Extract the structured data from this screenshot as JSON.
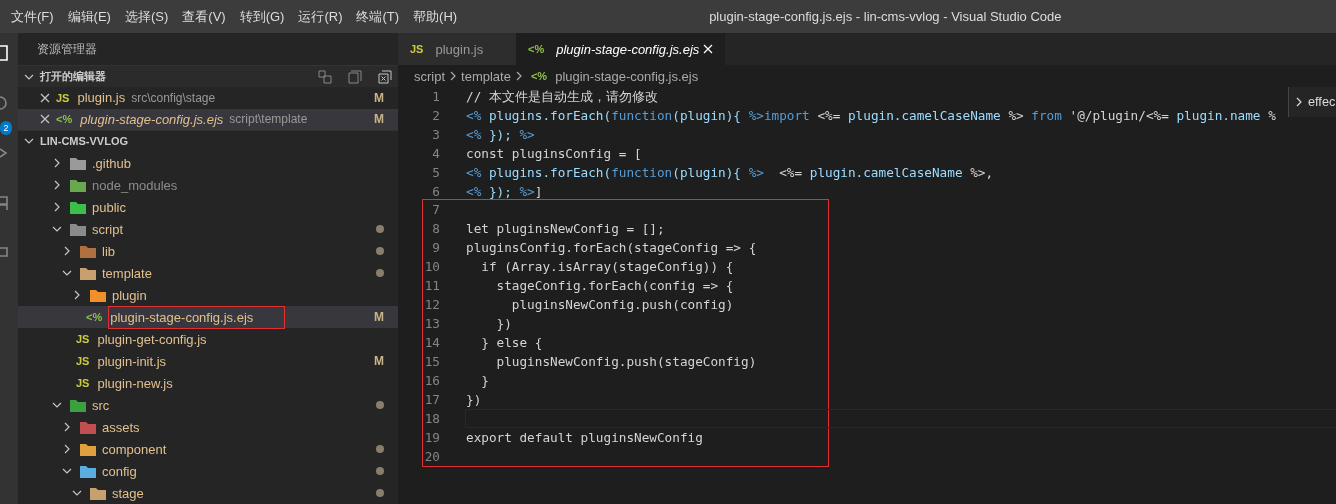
{
  "menu": [
    "文件(F)",
    "编辑(E)",
    "选择(S)",
    "查看(V)",
    "转到(G)",
    "运行(R)",
    "终端(T)",
    "帮助(H)"
  ],
  "window": {
    "title": "plugin-stage-config.js.ejs - lin-cms-vvlog - Visual Studio Code"
  },
  "activity_bar": {
    "badge": "2"
  },
  "sidebar": {
    "title": "资源管理器",
    "open_editors": {
      "title": "打开的编辑器",
      "expanded": true,
      "items": [
        {
          "icon": "JS",
          "kind": "js",
          "name": "plugin.js",
          "path": "src\\config\\stage",
          "badge": "M",
          "preview": false,
          "selected": false
        },
        {
          "icon": "<%",
          "kind": "ejs",
          "name": "plugin-stage-config.js.ejs",
          "path": "script\\template",
          "badge": "M",
          "preview": true,
          "selected": true
        }
      ]
    },
    "project": {
      "title": "LIN-CMS-VVLOG",
      "expanded": true
    }
  },
  "tree": {
    "items": [
      {
        "kind": "folder",
        "name": ".github",
        "color": "#9a9a9a",
        "expanded": false,
        "selected": false
      },
      {
        "kind": "folder",
        "name": "node_modules",
        "color": "#6aa84f",
        "expanded": false,
        "ignored": true,
        "selected": false
      },
      {
        "kind": "folder",
        "name": "public",
        "color": "#3cbf4a",
        "expanded": false,
        "selected": false
      },
      {
        "kind": "folder",
        "name": "script",
        "color": "#8a8a8a",
        "expanded": true,
        "modified_dot": true,
        "selected": false,
        "children": [
          {
            "kind": "folder",
            "name": "lib",
            "color": "#b07040",
            "expanded": false,
            "modified_dot": true,
            "selected": false
          },
          {
            "kind": "folder",
            "name": "template",
            "color": "#c8a070",
            "expanded": true,
            "modified_dot": true,
            "selected": false,
            "children": [
              {
                "kind": "folder",
                "name": "plugin",
                "color": "#f0902a",
                "expanded": false,
                "selected": false
              },
              {
                "kind": "file",
                "icon": "<%",
                "name": "plugin-stage-config.js.ejs",
                "badge": "M",
                "selected": true,
                "annotated": true
              }
            ]
          },
          {
            "kind": "file",
            "icon": "JS",
            "name": "plugin-get-config.js",
            "selected": false
          },
          {
            "kind": "file",
            "icon": "JS",
            "name": "plugin-init.js",
            "badge": "M",
            "selected": false
          },
          {
            "kind": "file",
            "icon": "JS",
            "name": "plugin-new.js",
            "selected": false
          }
        ]
      },
      {
        "kind": "folder",
        "name": "src",
        "color": "#3ca040",
        "expanded": true,
        "modified_dot": true,
        "selected": false,
        "children": [
          {
            "kind": "folder",
            "name": "assets",
            "color": "#c05050",
            "expanded": false,
            "selected": false
          },
          {
            "kind": "folder",
            "name": "component",
            "color": "#e0a040",
            "expanded": false,
            "modified_dot": true,
            "selected": false
          },
          {
            "kind": "folder",
            "name": "config",
            "color": "#5aaee0",
            "expanded": true,
            "modified_dot": true,
            "selected": false,
            "children": [
              {
                "kind": "folder",
                "name": "stage",
                "color": "#c8a070",
                "expanded": true,
                "modified_dot": true,
                "selected": false
              }
            ]
          }
        ]
      }
    ]
  },
  "tabs": [
    {
      "icon": "JS",
      "kind": "js",
      "label": "plugin.js",
      "selected": false,
      "preview": false
    },
    {
      "icon": "<%",
      "kind": "ejs",
      "label": "plugin-stage-config.js.ejs",
      "selected": true,
      "preview": true
    }
  ],
  "breadcrumb": [
    {
      "label": "script"
    },
    {
      "label": "template"
    },
    {
      "icon": "<%",
      "label": "plugin-stage-config.js.ejs"
    }
  ],
  "hover_widget": {
    "text": "effec"
  },
  "editor": {
    "lines": [
      {
        "number": "1",
        "tokens": [
          {
            "kind": "text",
            "text": "// 本文件是自动生成，请勿修改"
          }
        ]
      },
      {
        "number": "2",
        "tokens": [
          {
            "kind": "tag",
            "text": "<%"
          },
          {
            "kind": "var",
            "text": " plugins.forEach("
          },
          {
            "kind": "kw",
            "text": "function"
          },
          {
            "kind": "var",
            "text": "(plugin){ "
          },
          {
            "kind": "tag",
            "text": "%>"
          },
          {
            "kind": "kw",
            "text": "import"
          },
          {
            "kind": "text",
            "text": " <%="
          },
          {
            "kind": "var",
            "text": " plugin.camelCaseName"
          },
          {
            "kind": "text",
            "text": " %>"
          },
          {
            "kind": "kw",
            "text": " from"
          },
          {
            "kind": "text",
            "text": " '@/plugin/<%="
          },
          {
            "kind": "var",
            "text": " plugin.name"
          },
          {
            "kind": "text",
            "text": " %"
          }
        ]
      },
      {
        "number": "3",
        "tokens": [
          {
            "kind": "tag",
            "text": "<%"
          },
          {
            "kind": "var",
            "text": " });"
          },
          {
            "kind": "tag",
            "text": " %>"
          }
        ]
      },
      {
        "number": "4",
        "tokens": [
          {
            "kind": "text",
            "text": "const pluginsConfig = ["
          }
        ]
      },
      {
        "number": "5",
        "tokens": [
          {
            "kind": "tag",
            "text": "<%"
          },
          {
            "kind": "var",
            "text": " plugins.forEach("
          },
          {
            "kind": "kw",
            "text": "function"
          },
          {
            "kind": "var",
            "text": "(plugin){ "
          },
          {
            "kind": "tag",
            "text": "%>"
          },
          {
            "kind": "text",
            "text": "  <%="
          },
          {
            "kind": "var",
            "text": " plugin.camelCaseName"
          },
          {
            "kind": "text",
            "text": " %>,"
          }
        ]
      },
      {
        "number": "6",
        "tokens": [
          {
            "kind": "tag",
            "text": "<%"
          },
          {
            "kind": "var",
            "text": " });"
          },
          {
            "kind": "tag",
            "text": " %>"
          },
          {
            "kind": "text",
            "text": "]"
          }
        ]
      }
    ],
    "boxed_lines": [
      {
        "number": "7"
      },
      {
        "number": "8",
        "text": "let pluginsNewConfig = [];"
      },
      {
        "number": "9",
        "text": "pluginsConfig.forEach(stageConfig => {"
      },
      {
        "number": "10",
        "text": "  if (Array.isArray(stageConfig)) {"
      },
      {
        "number": "11",
        "text": "    stageConfig.forEach(config => {"
      },
      {
        "number": "12",
        "text": "      pluginsNewConfig.push(config)"
      },
      {
        "number": "13",
        "text": "    })"
      },
      {
        "number": "14",
        "text": "  } else {"
      },
      {
        "number": "15",
        "text": "    pluginsNewConfig.push(stageConfig)"
      },
      {
        "number": "16",
        "text": "  }"
      },
      {
        "number": "17",
        "text": "})"
      },
      {
        "number": "18",
        "current": true
      },
      {
        "number": "19",
        "text": "export default pluginsNewConfig"
      },
      {
        "number": "20"
      }
    ]
  }
}
